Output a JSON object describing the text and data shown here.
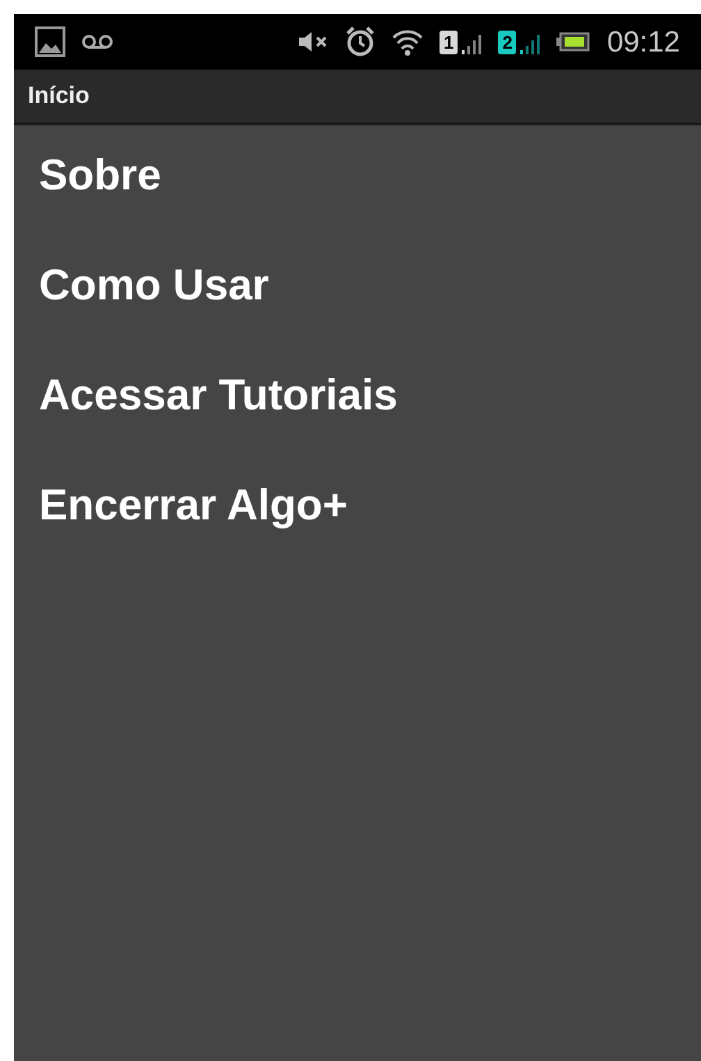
{
  "status_bar": {
    "sims": [
      {
        "label": "1",
        "color": "#d8d8d8"
      },
      {
        "label": "2",
        "color": "#19c9c0"
      }
    ],
    "time": "09:12"
  },
  "action_bar": {
    "title": "Início"
  },
  "menu": [
    {
      "label": "Sobre"
    },
    {
      "label": "Como Usar"
    },
    {
      "label": "Acessar Tutoriais"
    },
    {
      "label": "Encerrar Algo+"
    }
  ]
}
